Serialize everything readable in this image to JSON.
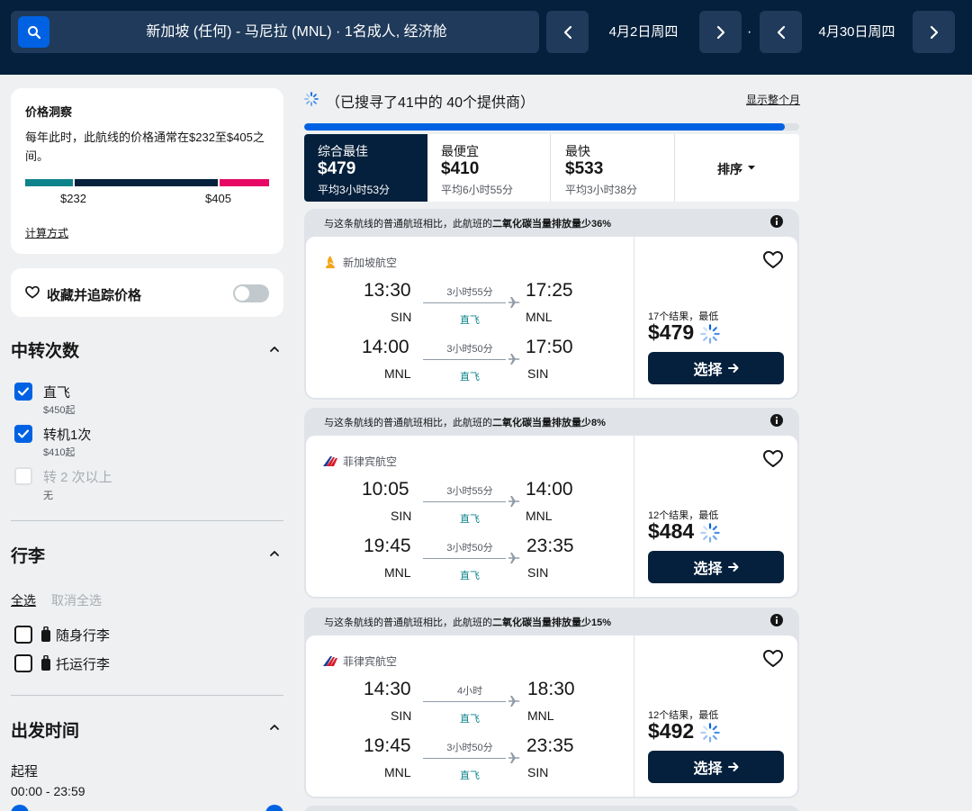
{
  "header": {
    "route_summary": "新加坡 (任何) - 马尼拉 (MNL) · 1名成人, 经济舱",
    "depart_date": "4月2日周四",
    "return_date": "4月30日周四",
    "date_separator": "·"
  },
  "price_insight": {
    "title": "价格洞察",
    "description": "每年此时，此航线的价格通常在$232至$405之间。",
    "low": "$232",
    "high": "$405",
    "calc_link": "计算方式"
  },
  "track": {
    "label": "收藏并追踪价格",
    "enabled": false
  },
  "stops_filter": {
    "title": "中转次数",
    "options": [
      {
        "label": "直飞",
        "sub": "$450起",
        "checked": true,
        "disabled": false
      },
      {
        "label": "转机1次",
        "sub": "$410起",
        "checked": true,
        "disabled": false
      },
      {
        "label": "转 2 次以上",
        "sub": "无",
        "checked": false,
        "disabled": true
      }
    ]
  },
  "baggage_filter": {
    "title": "行李",
    "select_all": "全选",
    "deselect_all": "取消全选",
    "options": [
      {
        "label": "随身行李",
        "checked": false
      },
      {
        "label": "托运行李",
        "checked": false
      }
    ]
  },
  "departure_time": {
    "title": "出发时间",
    "outbound_label": "起程",
    "outbound_range": "00:00 - 23:59"
  },
  "results_header": {
    "providers": "（已搜寻了41中的 40个提供商）",
    "show_month": "显示整个月",
    "progress": 0.97
  },
  "sort_tabs": [
    {
      "name": "综合最佳",
      "price": "$479",
      "time": "平均3小时53分",
      "active": true
    },
    {
      "name": "最便宜",
      "price": "$410",
      "time": "平均6小时55分",
      "active": false
    },
    {
      "name": "最快",
      "price": "$533",
      "time": "平均3小时38分",
      "active": false
    }
  ],
  "sort_label": "排序",
  "results": [
    {
      "eco_prefix": "与这条航线的普通航班相比，此航班的",
      "eco_strong": "二氧化碳当量排放量少36%",
      "airline": "新加坡航空",
      "logo": "singapore-airlines-logo",
      "legs": [
        {
          "dep_time": "13:30",
          "dep_code": "SIN",
          "duration": "3小时55分",
          "stops": "直飞",
          "arr_time": "17:25",
          "arr_code": "MNL"
        },
        {
          "dep_time": "14:00",
          "dep_code": "MNL",
          "duration": "3小时50分",
          "stops": "直飞",
          "arr_time": "17:50",
          "arr_code": "SIN"
        }
      ],
      "count": "17个结果，最低",
      "price": "$479",
      "select": "选择"
    },
    {
      "eco_prefix": "与这条航线的普通航班相比，此航班的",
      "eco_strong": "二氧化碳当量排放量少8%",
      "airline": "菲律宾航空",
      "logo": "philippine-airlines-logo",
      "legs": [
        {
          "dep_time": "10:05",
          "dep_code": "SIN",
          "duration": "3小时55分",
          "stops": "直飞",
          "arr_time": "14:00",
          "arr_code": "MNL"
        },
        {
          "dep_time": "19:45",
          "dep_code": "MNL",
          "duration": "3小时50分",
          "stops": "直飞",
          "arr_time": "23:35",
          "arr_code": "SIN"
        }
      ],
      "count": "12个结果，最低",
      "price": "$484",
      "select": "选择"
    },
    {
      "eco_prefix": "与这条航线的普通航班相比，此航班的",
      "eco_strong": "二氧化碳当量排放量少15%",
      "airline": "菲律宾航空",
      "logo": "philippine-airlines-logo",
      "legs": [
        {
          "dep_time": "14:30",
          "dep_code": "SIN",
          "duration": "4小时",
          "stops": "直飞",
          "arr_time": "18:30",
          "arr_code": "MNL"
        },
        {
          "dep_time": "19:45",
          "dep_code": "MNL",
          "duration": "3小时50分",
          "stops": "直飞",
          "arr_time": "23:35",
          "arr_code": "SIN"
        }
      ],
      "count": "12个结果，最低",
      "price": "$492",
      "select": "选择"
    }
  ],
  "colors": {
    "navy": "#05203c",
    "blue": "#0062e3",
    "teal": "#0c838a",
    "pink": "#e70866"
  }
}
